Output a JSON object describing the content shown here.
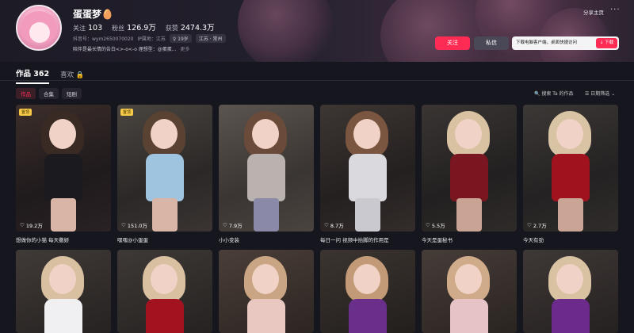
{
  "profile": {
    "nickname": "蛋蛋梦🥚",
    "following_label": "关注",
    "following": "103",
    "fans_label": "粉丝",
    "fans": "126.9万",
    "likes_label": "获赞",
    "likes": "2474.3万",
    "douyin_id": "抖音号：wym2650070020",
    "ip": "IP属地：江苏",
    "age": "♀ 19岁",
    "location": "江苏 · 常州",
    "bio": "陪伴是最长情的告白<>-o<-o 理想型：@蛋蛋...",
    "bio_more": "更多"
  },
  "header": {
    "share": "分享主页",
    "more": "···",
    "follow_button": "关注",
    "message_button": "私信",
    "download_text": "下载电脑客户端，桌面快捷访问",
    "download_button": "↓ 下载"
  },
  "tabs": {
    "works": "作品 362",
    "likes": "喜欢 🔒"
  },
  "chips": [
    "作品",
    "合集",
    "短剧"
  ],
  "toolbar": {
    "search": "🔍 搜索 Ta 的作品",
    "date_filter": "☰ 日期筛选 ⌄"
  },
  "pinned_label": "置顶",
  "videos_row1": [
    {
      "pinned": true,
      "likes": "19.2万",
      "caption": "想做你的小猫 每天撒娇"
    },
    {
      "pinned": true,
      "likes": "151.0万",
      "caption": "嘿嘿@小蛋蛋"
    },
    {
      "pinned": false,
      "likes": "7.9万",
      "caption": "小小变装"
    },
    {
      "pinned": false,
      "likes": "8.7万",
      "caption": "每日一问 视频中抬脚的作用是"
    },
    {
      "pinned": false,
      "likes": "5.5万",
      "caption": "今天是蛋秘书"
    },
    {
      "pinned": false,
      "likes": "2.7万",
      "caption": "今天有劲"
    }
  ],
  "colors": {
    "accent": "#fe2c55",
    "background": "#16161e"
  }
}
